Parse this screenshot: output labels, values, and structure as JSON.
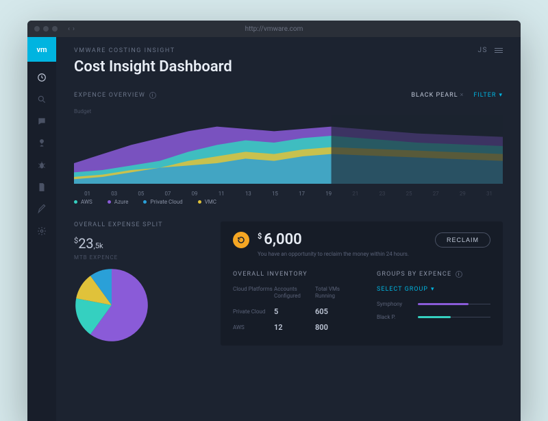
{
  "browser": {
    "url": "http://vmware.com"
  },
  "logo": "vm",
  "breadcrumb": "VMWARE COSTING INSIGHT",
  "user_initials": "JS",
  "page_title": "Cost Insight Dashboard",
  "expense_section": {
    "title": "EXPENCE OVERVIEW",
    "budget_label": "Budget",
    "tag": "BLACK PEARL",
    "filter_label": "FILTER"
  },
  "chart_data": {
    "type": "area",
    "title": "Expence Overview",
    "xlabel": "",
    "ylabel": "",
    "x": [
      "01",
      "03",
      "05",
      "07",
      "09",
      "11",
      "13",
      "15",
      "17",
      "19",
      "21",
      "23",
      "25",
      "27",
      "29",
      "31"
    ],
    "active_x_end_index": 9,
    "series": [
      {
        "name": "AWS",
        "color": "#35d0c0",
        "values": [
          10,
          12,
          16,
          20,
          28,
          34,
          38,
          36,
          40,
          42,
          40,
          38,
          36,
          35,
          34,
          33
        ]
      },
      {
        "name": "Azure",
        "color": "#8a5bd8",
        "values": [
          18,
          26,
          34,
          40,
          46,
          50,
          48,
          46,
          48,
          50,
          48,
          46,
          44,
          43,
          42,
          41
        ]
      },
      {
        "name": "Private Cloud",
        "color": "#2aa0d8",
        "values": [
          4,
          6,
          10,
          14,
          16,
          18,
          22,
          20,
          24,
          26,
          25,
          24,
          23,
          22,
          21,
          20
        ]
      },
      {
        "name": "VMC",
        "color": "#e0c23a",
        "values": [
          6,
          8,
          12,
          14,
          20,
          24,
          28,
          26,
          30,
          32,
          31,
          30,
          29,
          28,
          27,
          26
        ]
      }
    ],
    "ylim": [
      0,
      60
    ]
  },
  "legend": [
    {
      "label": "AWS",
      "color": "#35d0c0"
    },
    {
      "label": "Azure",
      "color": "#8a5bd8"
    },
    {
      "label": "Private Cloud",
      "color": "#2aa0d8"
    },
    {
      "label": "VMC",
      "color": "#e0c23a"
    }
  ],
  "split": {
    "title": "OVERALL EXPENSE SPLIT",
    "currency": "$",
    "amount": "23",
    "amount_frac": ",5k",
    "sub_label": "MTB EXPENCE",
    "pie": [
      {
        "name": "Azure",
        "value": 60,
        "color": "#8a5bd8"
      },
      {
        "name": "AWS",
        "value": 18,
        "color": "#35d0c0"
      },
      {
        "name": "VMC",
        "value": 12,
        "color": "#e0c23a"
      },
      {
        "name": "Private Cloud",
        "value": 10,
        "color": "#2aa0d8"
      }
    ]
  },
  "reclaim": {
    "currency": "$",
    "amount": "6,000",
    "subtext": "You have an opportunity to reclaim the money within 24 hours.",
    "button": "RECLAIM"
  },
  "inventory": {
    "title": "OVERALL INVENTORY",
    "columns": [
      "Cloud Platforms",
      "Accounts Configured",
      "Total VMs Running"
    ],
    "rows": [
      {
        "label": "Private Cloud",
        "accounts": "5",
        "vms": "605"
      },
      {
        "label": "AWS",
        "accounts": "12",
        "vms": "800"
      }
    ]
  },
  "groups": {
    "title": "GROUPS BY EXPENCE",
    "select_label": "SELECT GROUP",
    "items": [
      {
        "label": "Symphony",
        "pct": 70,
        "color": "#8a5bd8"
      },
      {
        "label": "Black P.",
        "pct": 45,
        "color": "#35d0c0"
      }
    ]
  }
}
